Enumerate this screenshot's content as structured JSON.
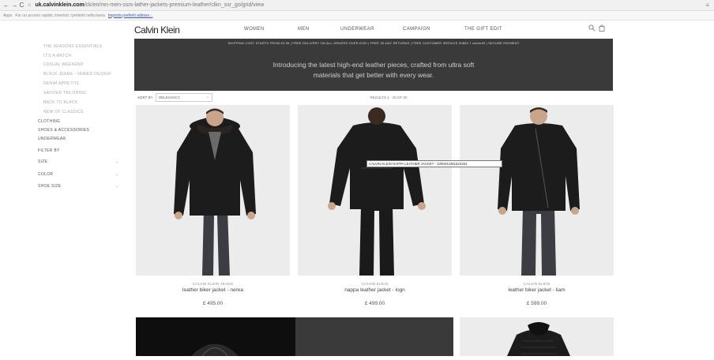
{
  "browser": {
    "nav_glyphs": "← → C",
    "home_glyph": "⌂",
    "url_domain": "uk.calvinklein.com",
    "url_rest": "/ck/en/mn-men-ssrs-lather-jackets-premium-leather/clkn_ssr_go/grid/view",
    "menu_glyph": "≡"
  },
  "bookmarks": {
    "apps_label": "Apps",
    "message": "For un acceso rapido, inserisci i preferiti nella barra",
    "import_link": "Importa preferiti adesso..."
  },
  "header": {
    "logo": "Calvin Klein",
    "nav": [
      "WOMEN",
      "MEN",
      "UNDERWEAR",
      "CAMPAIGN",
      "THE GIFT EDIT"
    ],
    "search_icon": "search-icon",
    "bag_icon": "shopping-bag-icon"
  },
  "hero": {
    "shipping": "SHIPPING COST STARTS FROM £3.95 | FREE DELIVERY ON ALL ORDERS OVER £150 | FREE 30-DAY RETURNS | FREE CUSTOMER SERVICE 00800 7 calvin99 | SECURE PAYMENT",
    "line1": "Introducing the latest high-end leather pieces, crafted from ultra soft",
    "line2": "materials that get better with every wear."
  },
  "sidebar": {
    "sub_items": [
      "THE SEASONS ESSENTIALS",
      "IT'S A MATCH",
      "CASUAL WEEKEND",
      "BLACK JEANS - VARIED DESIGN",
      "DENIM APPETITE",
      "SAVVIER TAILORING",
      "BACK TO BLACK",
      "NEW OF CLASSICS"
    ],
    "main_items": [
      "CLOTHING",
      "SHOES & ACCESSORIES",
      "UNDERWEAR"
    ],
    "filter_title": "FILTER BY",
    "filters": [
      "SIZE",
      "COLOR",
      "SHOE SIZE"
    ]
  },
  "sort": {
    "label": "SORT BY",
    "value": "RELEVANCY",
    "results": "RESULTS 1 - 20 OF 20"
  },
  "products": [
    {
      "brand": "CALVIN KLEIN JEANS",
      "name": "leather biker jacket - nerea",
      "price": "£ 495.00"
    },
    {
      "brand": "CALVIN KLEIN",
      "name": "nappa leather jacket - logn",
      "price": "£ 499.00"
    },
    {
      "brand": "CALVIN KLEIN",
      "name": "leather biker jacket - liam",
      "price": "£ 599.00"
    }
  ],
  "tooltip": "CALVIN KLEIN NAPPA LEATHER JACKET - 1000042351623263",
  "colors": {
    "hero_bg": "#3a3a3a",
    "jacket": "#1c1c1c",
    "jeans": "#3b3d42"
  }
}
